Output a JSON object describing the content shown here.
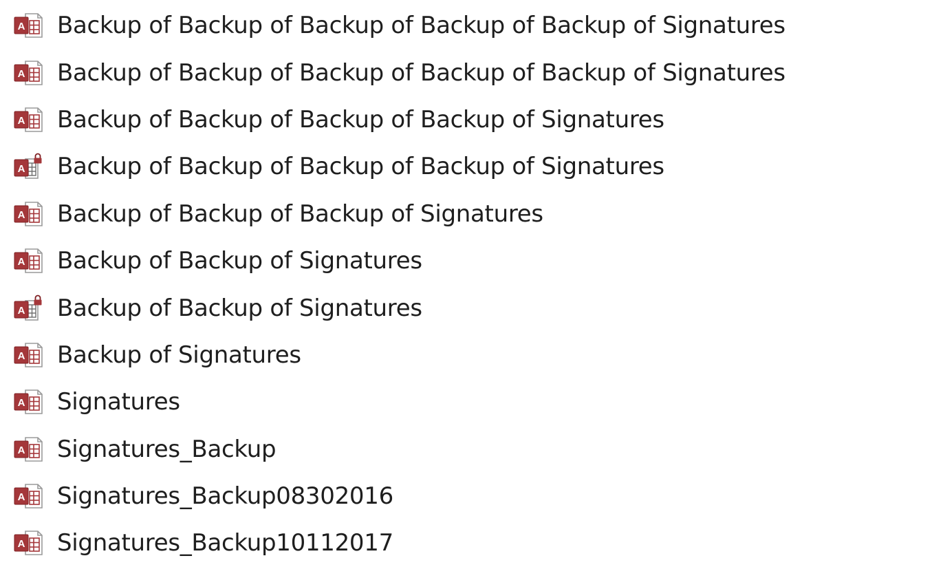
{
  "files": [
    {
      "name": "Backup of Backup of Backup of Backup of Backup of Signatures",
      "icon": "access-database-icon"
    },
    {
      "name": "Backup of Backup of Backup of Backup of Backup of Signatures",
      "icon": "access-database-icon"
    },
    {
      "name": "Backup of Backup of Backup of Backup of Signatures",
      "icon": "access-database-icon"
    },
    {
      "name": "Backup of Backup of Backup of Backup of Signatures",
      "icon": "access-lock-file-icon"
    },
    {
      "name": "Backup of Backup of Backup of Signatures",
      "icon": "access-database-icon"
    },
    {
      "name": "Backup of Backup of Signatures",
      "icon": "access-database-icon"
    },
    {
      "name": "Backup of Backup of Signatures",
      "icon": "access-lock-file-icon"
    },
    {
      "name": "Backup of Signatures",
      "icon": "access-database-icon"
    },
    {
      "name": "Signatures",
      "icon": "access-database-icon"
    },
    {
      "name": "Signatures_Backup",
      "icon": "access-database-icon"
    },
    {
      "name": "Signatures_Backup08302016",
      "icon": "access-database-icon"
    },
    {
      "name": "Signatures_Backup10112017",
      "icon": "access-database-icon"
    }
  ],
  "colors": {
    "access_brand": "#a4373a",
    "access_brand_dark": "#7e1f22",
    "text": "#1e1e1e"
  }
}
